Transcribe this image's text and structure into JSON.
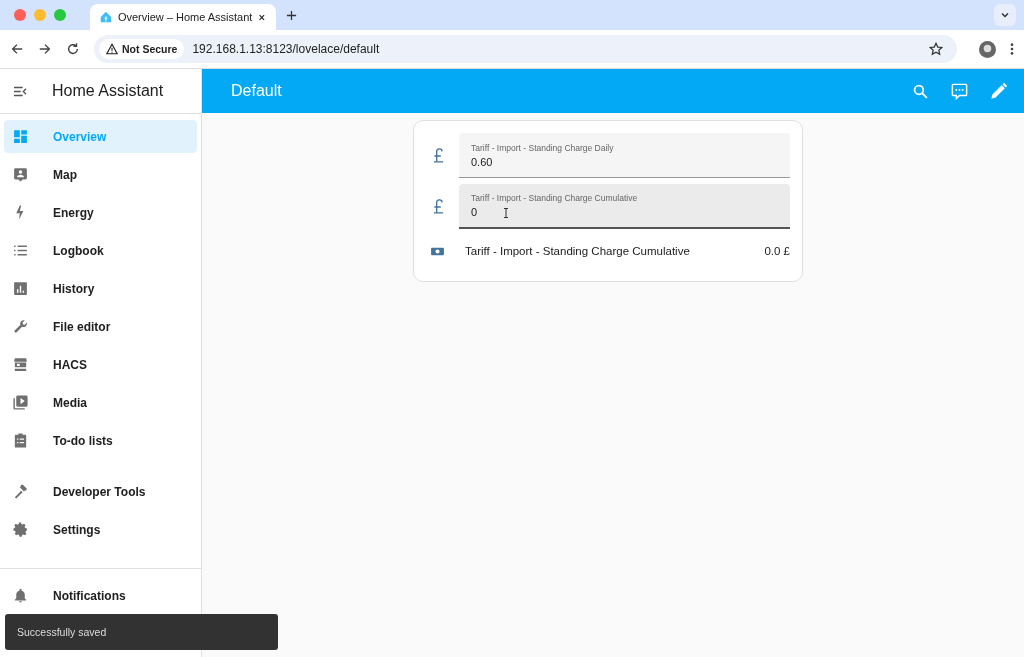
{
  "browser": {
    "tab_title": "Overview – Home Assistant",
    "security": "Not Secure",
    "url": "192.168.1.13:8123/lovelace/default"
  },
  "sidebar": {
    "title": "Home Assistant",
    "items": [
      {
        "label": "Overview",
        "selected": true
      },
      {
        "label": "Map",
        "selected": false
      },
      {
        "label": "Energy",
        "selected": false
      },
      {
        "label": "Logbook",
        "selected": false
      },
      {
        "label": "History",
        "selected": false
      },
      {
        "label": "File editor",
        "selected": false
      },
      {
        "label": "HACS",
        "selected": false
      },
      {
        "label": "Media",
        "selected": false
      },
      {
        "label": "To-do lists",
        "selected": false
      }
    ],
    "tools": [
      {
        "label": "Developer Tools",
        "selected": false
      },
      {
        "label": "Settings",
        "selected": false
      }
    ],
    "notifications": "Notifications"
  },
  "header": {
    "title": "Default"
  },
  "card": {
    "fields": [
      {
        "label": "Tariff - Import - Standing Charge Daily",
        "value": "0.60",
        "focused": false
      },
      {
        "label": "Tariff - Import - Standing Charge Cumulative",
        "value": "0",
        "focused": true
      }
    ],
    "sensor": {
      "name": "Tariff - Import - Standing Charge Cumulative",
      "value": "0.0 £"
    }
  },
  "toast": "Successfully saved"
}
